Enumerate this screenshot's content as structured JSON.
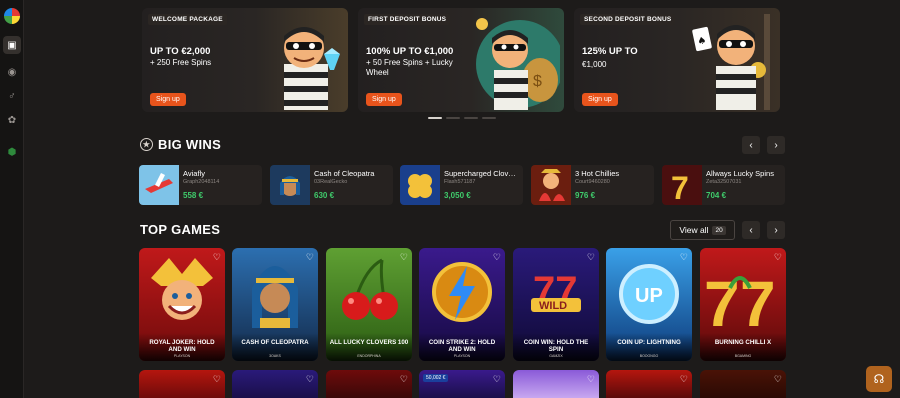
{
  "colors": {
    "accent": "#e8541c",
    "win_green": "#3fcb6b",
    "background": "#1d1b1a"
  },
  "sidebar": {
    "items": [
      {
        "icon": "ticket-icon"
      },
      {
        "icon": "live-signal-icon"
      },
      {
        "icon": "running-person-icon"
      },
      {
        "icon": "gift-icon"
      },
      {
        "icon": "shield-icon"
      }
    ]
  },
  "banners": [
    {
      "tag": "WELCOME PACKAGE",
      "title": "UP TO €2,000",
      "sub": "+ 250 Free Spins",
      "button": "Sign up"
    },
    {
      "tag": "FIRST DEPOSIT BONUS",
      "title": "100% UP TO €1,000",
      "sub": "+ 50 Free Spins + Lucky Wheel",
      "button": "Sign up"
    },
    {
      "tag": "SECOND DEPOSIT BONUS",
      "title": "125% UP TO",
      "sub": "€1,000",
      "button": "Sign up"
    }
  ],
  "big_wins": {
    "title": "BIG WINS",
    "items": [
      {
        "game": "Aviafly",
        "user": "Graph2048114",
        "amount": "558 €"
      },
      {
        "game": "Cash of Cleopatra",
        "user": "03RealGecko",
        "amount": "630 €"
      },
      {
        "game": "Supercharged Clov…",
        "user": "Flash571187",
        "amount": "3,050 €"
      },
      {
        "game": "3 Hot Chillies",
        "user": "Court9460280",
        "amount": "976 €"
      },
      {
        "game": "Allways Lucky Spins",
        "user": "Zeta32507031",
        "amount": "704 €"
      }
    ]
  },
  "top_games": {
    "title": "TOP GAMES",
    "view_all": "View all",
    "count": "20",
    "items": [
      {
        "name": "ROYAL JOKER: HOLD AND WIN",
        "provider": "PLAYSON"
      },
      {
        "name": "CASH OF CLEOPATRA",
        "provider": "3OAKS"
      },
      {
        "name": "ALL LUCKY CLOVERS 100",
        "provider": "ENDORPHINA"
      },
      {
        "name": "COIN STRIKE 2: HOLD AND WIN",
        "provider": "PLAYSON"
      },
      {
        "name": "COIN WIN: HOLD THE SPIN",
        "provider": "GAMZIX"
      },
      {
        "name": "COIN UP: LIGHTNING",
        "provider": "BOOONGO"
      },
      {
        "name": "BURNING CHILLI X",
        "provider": "BGAMING"
      }
    ],
    "second_row_badge": "50,002 €"
  }
}
